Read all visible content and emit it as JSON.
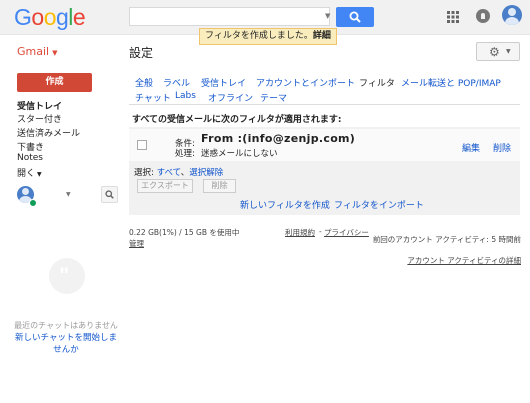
{
  "header": {
    "logo": [
      "G",
      "o",
      "o",
      "g",
      "l",
      "e"
    ],
    "search_placeholder": "",
    "toast": {
      "message": "フィルタを作成しました。",
      "link": "詳細"
    }
  },
  "sidebar": {
    "app_menu": "Gmail",
    "compose": "作成",
    "items": [
      {
        "label": "受信トレイ",
        "bold": true
      },
      {
        "label": "スター付き",
        "bold": false
      },
      {
        "label": "送信済みメール",
        "bold": false
      },
      {
        "label": "下書き",
        "bold": false
      },
      {
        "label": "Notes",
        "bold": false
      },
      {
        "label": "開く",
        "bold": false
      }
    ],
    "no_chats": "最近のチャットはありません",
    "start_chat": "新しいチャットを開始しませんか"
  },
  "main": {
    "title": "設定",
    "tabs_row1": [
      "全般",
      "ラベル",
      "受信トレイ",
      "アカウントとインポート",
      "フィルタ",
      "メール転送と POP/IMAP"
    ],
    "tabs_row2": [
      "チャット",
      "Labs",
      "オフライン",
      "テーマ"
    ],
    "current_tab": "フィルタ",
    "filters_heading": "すべての受信メールに次のフィルタが適用されます:",
    "filter": {
      "criteria_label": "条件:",
      "criteria_value": "From :(info@zenjp.com)",
      "action_label": "処理:",
      "action_value": "迷惑メールにしない",
      "edit": "編集",
      "delete": "削除"
    },
    "select": {
      "label": "選択:",
      "all": "すべて",
      "sep": "、",
      "none": "選択解除"
    },
    "export_button": "エクスポート",
    "delete_button": "削除",
    "create_filter": "新しいフィルタを作成",
    "import_filter": "フィルタをインポート"
  },
  "footer": {
    "storage": "0.22 GB(1%) / 15 GB を使用中",
    "manage": "管理",
    "terms": "利用規約",
    "separator": "-",
    "privacy": "プライバシー",
    "last_activity": "前回のアカウント アクティビティ: 5 時間前",
    "details": "アカウント アクティビティの詳細"
  }
}
